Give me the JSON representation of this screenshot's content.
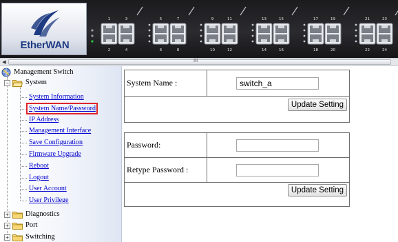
{
  "header": {
    "brand_prefix": "Ether",
    "brand_suffix": "WAN",
    "port_top_labels": [
      "1",
      "3",
      "5",
      "7",
      "9",
      "11",
      "13",
      "15",
      "17",
      "19",
      "21",
      "23"
    ],
    "port_bottom_labels": [
      "2",
      "4",
      "6",
      "8",
      "10",
      "12",
      "14",
      "16",
      "18",
      "20",
      "22",
      "24"
    ],
    "scroll_grip": "III"
  },
  "sidebar": {
    "root_label": "Management Switch",
    "system_label": "System",
    "system_items": [
      "System Information",
      "System Name/Password",
      "IP Address",
      "Management Interface",
      "Save Configuration",
      "Firmware Upgrade",
      "Reboot",
      "Logout",
      "User Account",
      "User Privilege"
    ],
    "selected_item": "System Name/Password",
    "other_groups": [
      "Diagnostics",
      "Port",
      "Switching"
    ]
  },
  "main": {
    "system_name_label": "System Name :",
    "system_name_value": "switch_a",
    "update_button_1": "Update Setting",
    "password_label": "Password:",
    "password_value": "",
    "retype_label": "Retype Password :",
    "retype_value": "",
    "update_button_2": "Update Setting"
  },
  "colors": {
    "brand_blue": "#1f3c83",
    "link_blue": "#0000cc",
    "selection_red": "#e0242a",
    "header_dark": "#1b1b1d",
    "led_green": "#2ecc40"
  }
}
